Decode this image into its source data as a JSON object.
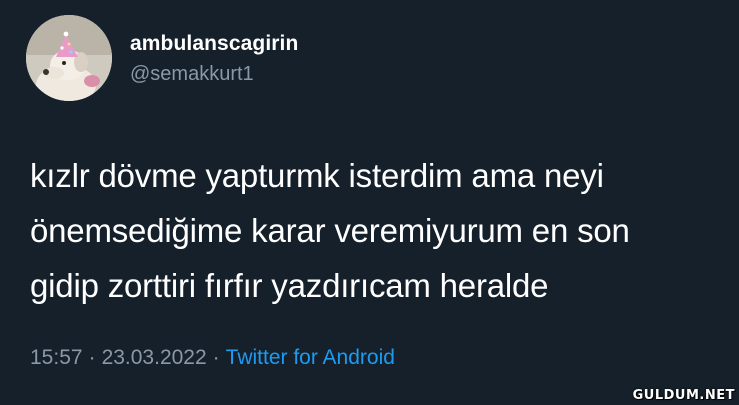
{
  "user": {
    "display_name": "ambulanscagirin",
    "handle": "@semakkurt1",
    "avatar_icon": "dog-with-party-hat-avatar"
  },
  "tweet": {
    "lines": [
      "kızlr dövme yapturmk isterdim ama neyi",
      "önemsediğime karar veremiyurum en son",
      "gidip zorttiri fırfır yazdırıcam heralde"
    ],
    "time": "15:57",
    "separator": "·",
    "date": "23.03.2022",
    "source": "Twitter for Android"
  },
  "watermark": "GULDUM.NET",
  "colors": {
    "background": "#15202b",
    "text": "#ffffff",
    "muted": "#8b98a5",
    "link": "#1d9bf0"
  }
}
